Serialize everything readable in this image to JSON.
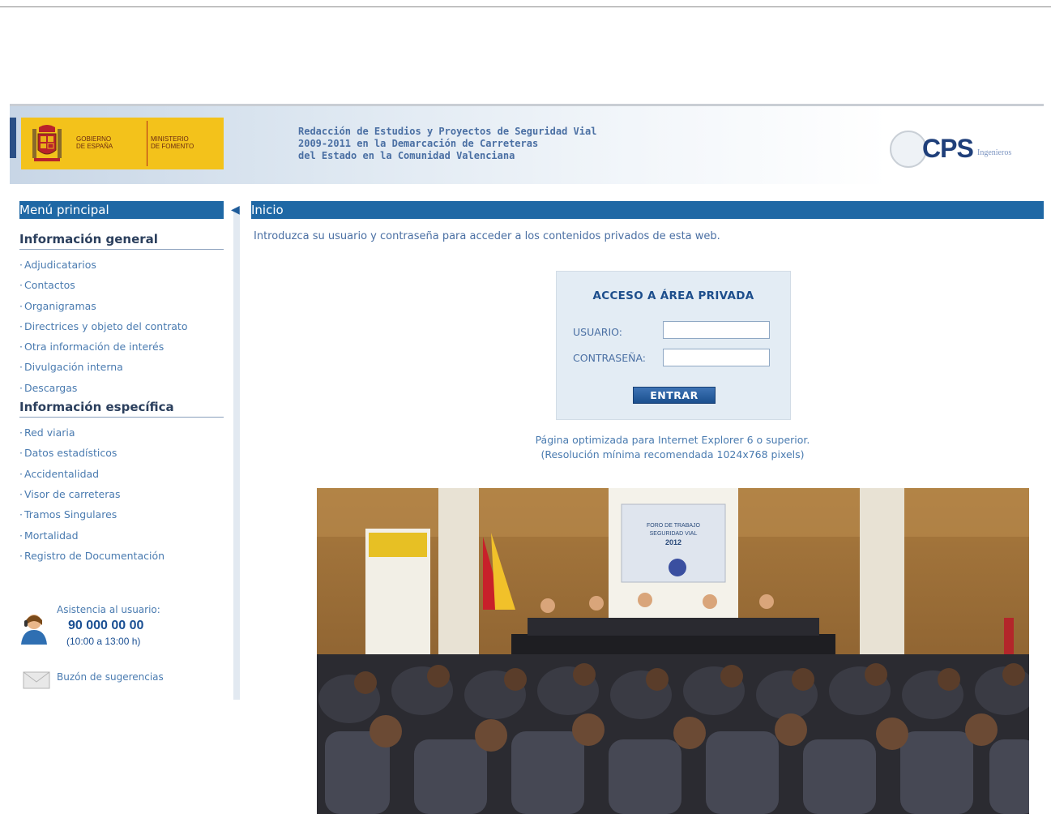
{
  "colors": {
    "bar_blue": "#1f68a5",
    "link_blue": "#4a7bb0",
    "title_blue": "#1d4e8c",
    "gov_yellow": "#f3c21b",
    "login_bg": "#e3ecf4"
  },
  "header": {
    "gov_label": "GOBIERNO\nDE ESPAÑA",
    "ministry_label": "MINISTERIO\nDE FOMENTO",
    "title_line1": "Redacción de Estudios y Proyectos de Seguridad Vial",
    "title_line2": "2009-2011 en la Demarcación de Carreteras",
    "title_line3": "del Estado en la Comunidad Valenciana",
    "brand": "CPS",
    "brand_sub": "Ingenieros"
  },
  "sidebar": {
    "menu_title": "Menú principal",
    "section1_title": "Información general",
    "section1_items": [
      "Adjudicatarios",
      "Contactos",
      "Organigramas",
      "Directrices y objeto del contrato",
      "Otra información de interés",
      "Divulgación interna",
      "Descargas"
    ],
    "section2_title": "Información específica",
    "section2_items": [
      "Red viaria",
      "Datos estadísticos",
      "Accidentalidad",
      "Visor de carreteras",
      "Tramos Singulares",
      "Mortalidad",
      "Registro de Documentación"
    ],
    "support_label": "Asistencia al usuario:",
    "support_phone": "90 000 00 00",
    "support_hours": "(10:00 a 13:00 h)",
    "mailbox_label": "Buzón de sugerencias"
  },
  "main": {
    "bar_title": "Inicio",
    "intro": "Introduzca su usuario y contraseña para acceder a los contenidos privados de esta web.",
    "login": {
      "title": "ACCESO A ÁREA PRIVADA",
      "user_label": "USUARIO:",
      "user_value": "",
      "pass_label": "CONTRASEÑA:",
      "pass_value": "",
      "submit": "ENTRAR"
    },
    "note_line1": "Página optimizada para Internet Explorer 6 o superior.",
    "note_line2": "(Resolución mínima recomendada 1024x768 pixels)"
  },
  "photo": {
    "screen_line1": "FORO DE TRABAJO",
    "screen_line2": "SEGURIDAD VIAL",
    "screen_line3": "2012"
  }
}
